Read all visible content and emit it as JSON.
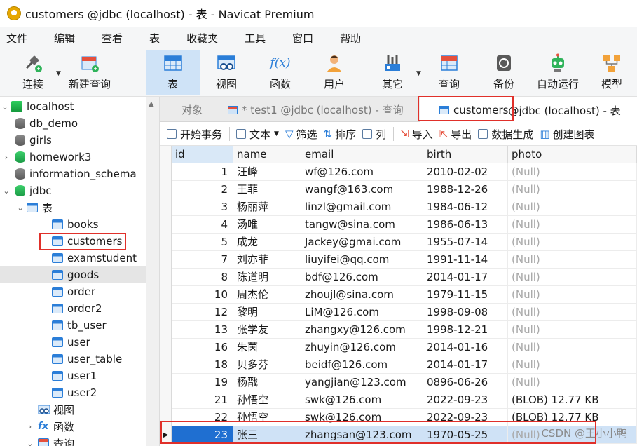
{
  "window": {
    "title": "customers @jdbc (localhost) - 表 - Navicat Premium"
  },
  "menu": [
    "文件",
    "编辑",
    "查看",
    "表",
    "收藏夹",
    "工具",
    "窗口",
    "帮助"
  ],
  "toolbar": [
    {
      "label": "连接",
      "icon": "plug-icon"
    },
    {
      "label": "新建查询",
      "icon": "new-query-icon"
    },
    {
      "label": "表",
      "icon": "table-icon",
      "active": true
    },
    {
      "label": "视图",
      "icon": "view-icon"
    },
    {
      "label": "函数",
      "icon": "function-icon",
      "glyph": "f(x)"
    },
    {
      "label": "用户",
      "icon": "user-icon"
    },
    {
      "label": "其它",
      "icon": "tools-icon"
    },
    {
      "label": "查询",
      "icon": "query-icon"
    },
    {
      "label": "备份",
      "icon": "backup-icon"
    },
    {
      "label": "自动运行",
      "icon": "robot-icon"
    },
    {
      "label": "模型",
      "icon": "model-icon"
    }
  ],
  "tree": {
    "host": "localhost",
    "databases": [
      "db_demo",
      "girls",
      "homework3",
      "information_schema",
      "jdbc"
    ],
    "tables_group": "表",
    "tables": [
      "books",
      "customers",
      "examstudent",
      "goods",
      "order",
      "order2",
      "tb_user",
      "user",
      "user_table",
      "user1",
      "user2"
    ],
    "views": "视图",
    "functions": "函数",
    "queries": "查询"
  },
  "tabs": {
    "objects": "对象",
    "query_tab": "* test1 @jdbc (localhost) - 查询",
    "table_tab_name": "customers",
    "table_tab_rest": " @jdbc (localhost) - 表"
  },
  "subtoolbar": {
    "begin_tx": "开始事务",
    "text": "文本",
    "filter": "筛选",
    "sort": "排序",
    "columns": "列",
    "import": "导入",
    "export": "导出",
    "generate": "数据生成",
    "create_chart": "创建图表"
  },
  "grid": {
    "columns": [
      "id",
      "name",
      "email",
      "birth",
      "photo"
    ],
    "rows": [
      [
        "1",
        "汪峰",
        "wf@126.com",
        "2010-02-02",
        "(Null)"
      ],
      [
        "2",
        "王菲",
        "wangf@163.com",
        "1988-12-26",
        "(Null)"
      ],
      [
        "3",
        "杨丽萍",
        "linzl@gmail.com",
        "1984-06-12",
        "(Null)"
      ],
      [
        "4",
        "汤唯",
        "tangw@sina.com",
        "1986-06-13",
        "(Null)"
      ],
      [
        "5",
        "成龙",
        "Jackey@gmai.com",
        "1955-07-14",
        "(Null)"
      ],
      [
        "7",
        "刘亦菲",
        "liuyifei@qq.com",
        "1991-11-14",
        "(Null)"
      ],
      [
        "8",
        "陈道明",
        "bdf@126.com",
        "2014-01-17",
        "(Null)"
      ],
      [
        "10",
        "周杰伦",
        "zhoujl@sina.com",
        "1979-11-15",
        "(Null)"
      ],
      [
        "12",
        "黎明",
        "LiM@126.com",
        "1998-09-08",
        "(Null)"
      ],
      [
        "13",
        "张学友",
        "zhangxy@126.com",
        "1998-12-21",
        "(Null)"
      ],
      [
        "16",
        "朱茵",
        "zhuyin@126.com",
        "2014-01-16",
        "(Null)"
      ],
      [
        "18",
        "贝多芬",
        "beidf@126.com",
        "2014-01-17",
        "(Null)"
      ],
      [
        "19",
        "杨戬",
        "yangjian@123.com",
        "0896-06-26",
        "(Null)"
      ],
      [
        "21",
        "孙悟空",
        "swk@126.com",
        "2022-09-23",
        "(BLOB) 12.77 KB"
      ],
      [
        "22",
        "孙悟空",
        "swk@126.com",
        "2022-09-23",
        "(BLOB) 12.77 KB"
      ],
      [
        "23",
        "张三",
        "zhangsan@123.com",
        "1970-05-25",
        "(Null)"
      ]
    ]
  },
  "watermark": "CSDN @王小小鸭",
  "colors": {
    "accent": "#1f6fd1",
    "highlight_box": "#e0302a",
    "selected_row": "#cfe2f6"
  }
}
